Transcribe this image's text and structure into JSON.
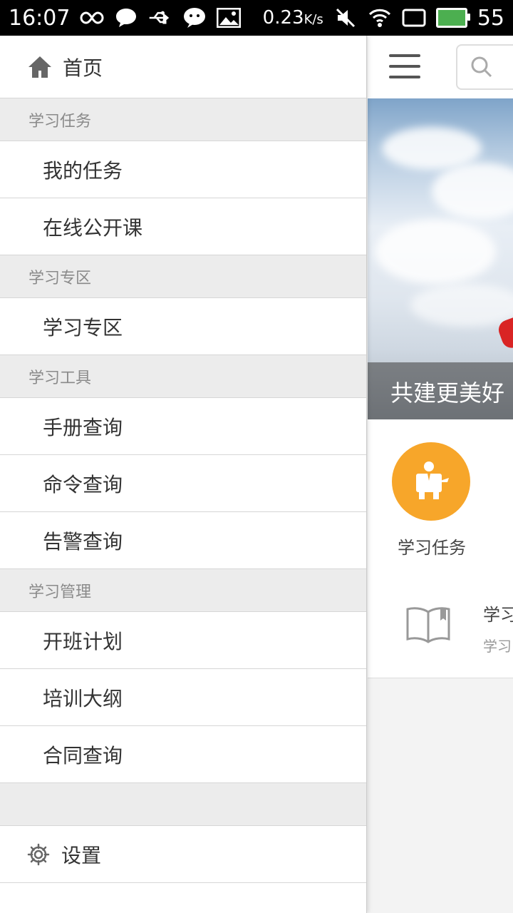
{
  "status_bar": {
    "time": "16:07",
    "net_speed": "0.23",
    "net_unit": "K/s",
    "battery": "55",
    "left_icons": [
      "infinity-icon",
      "chat-bubble-icon",
      "usb-icon",
      "wechat-icon",
      "image-icon"
    ],
    "right_icons": [
      "mute-icon",
      "wifi-icon",
      "screen-icon",
      "battery-icon"
    ]
  },
  "drawer": {
    "home_label": "首页",
    "sections": [
      {
        "title": "学习任务",
        "items": [
          "我的任务",
          "在线公开课"
        ]
      },
      {
        "title": "学习专区",
        "items": [
          "学习专区"
        ]
      },
      {
        "title": "学习工具",
        "items": [
          "手册查询",
          "命令查询",
          "告警查询"
        ]
      },
      {
        "title": "学习管理",
        "items": [
          "开班计划",
          "培训大纲",
          "合同查询"
        ]
      }
    ],
    "settings_label": "设置"
  },
  "main": {
    "banner_caption": "共建更美好",
    "quick_entry_label": "学习任务",
    "list_item_title": "学习",
    "list_item_subtitle": "学习"
  },
  "colors": {
    "accent_orange": "#f7a62a",
    "section_bg": "#ececec",
    "status_bar_bg": "#000000"
  }
}
